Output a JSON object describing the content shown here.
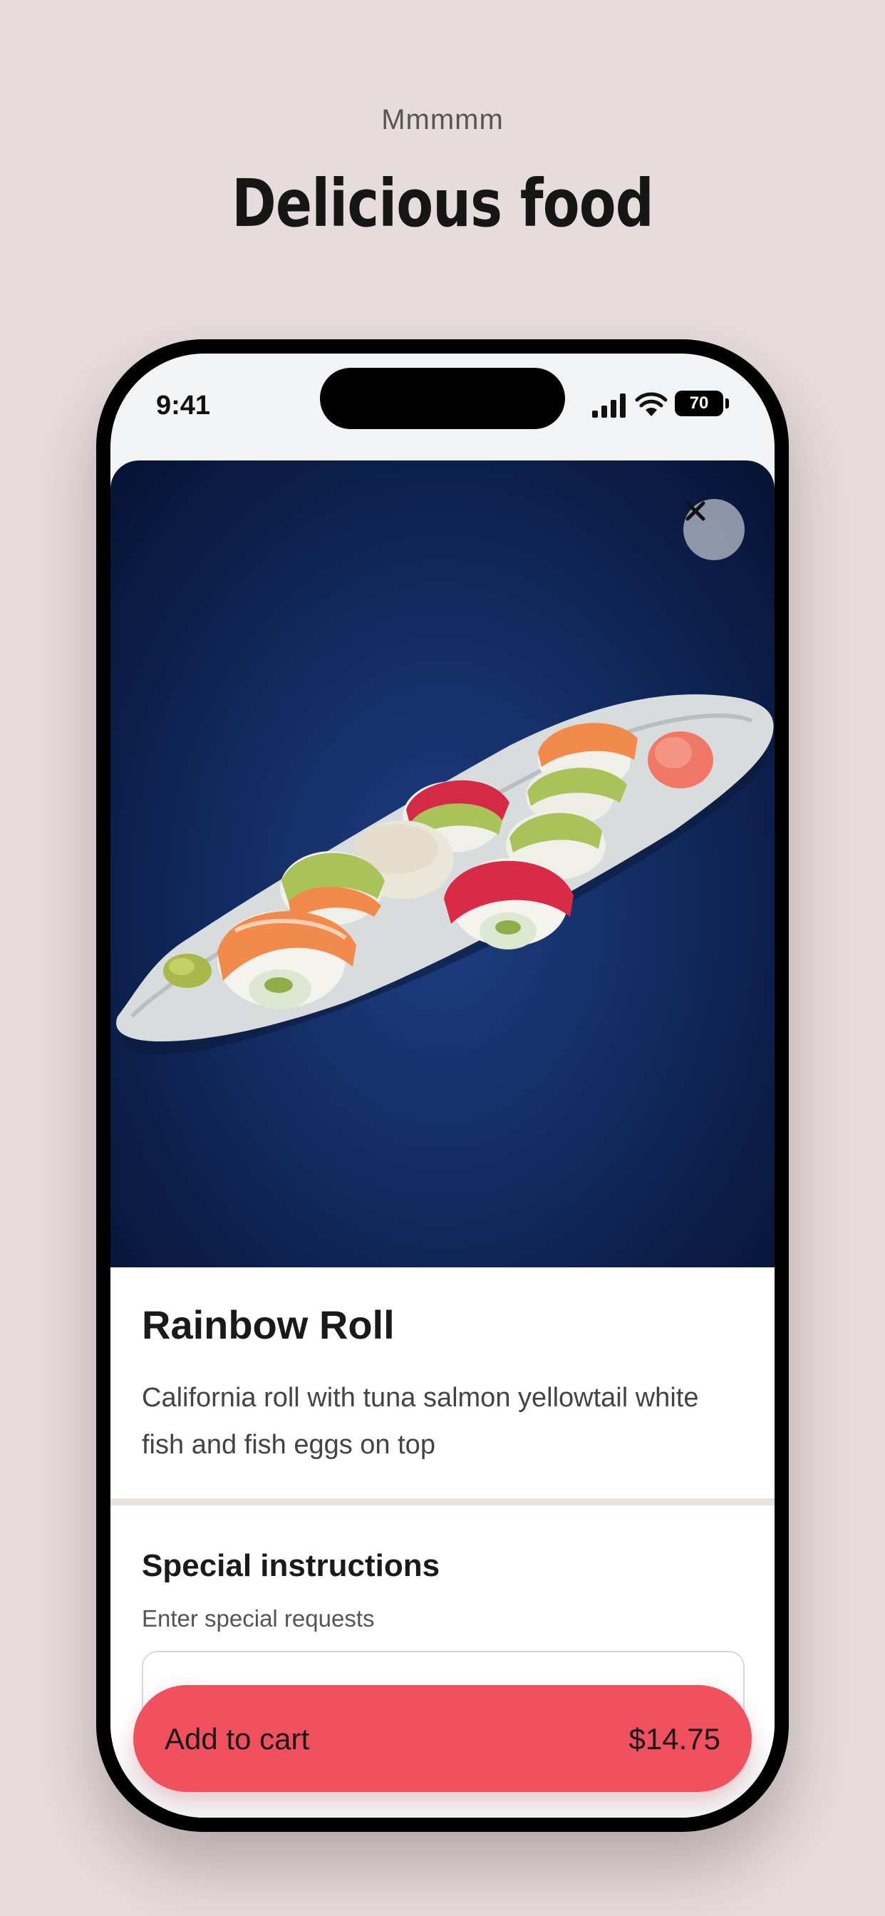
{
  "header": {
    "eyebrow": "Mmmmm",
    "headline": "Delicious food"
  },
  "status_bar": {
    "time": "9:41",
    "battery": "70",
    "icons": [
      "cellular-signal-icon",
      "wifi-icon",
      "battery-icon"
    ]
  },
  "item": {
    "image_description": "close-icon",
    "name": "Rainbow Roll",
    "description": "California roll with tuna salmon yellowtail white fish and fish eggs on top"
  },
  "special_instructions": {
    "title": "Special instructions",
    "subtitle": "Enter special requests",
    "value": ""
  },
  "cart": {
    "label": "Add to cart",
    "price": "$14.75"
  },
  "colors": {
    "background": "#e6dcdc",
    "accent": "#f1505e",
    "hero_background": "#10275a"
  }
}
